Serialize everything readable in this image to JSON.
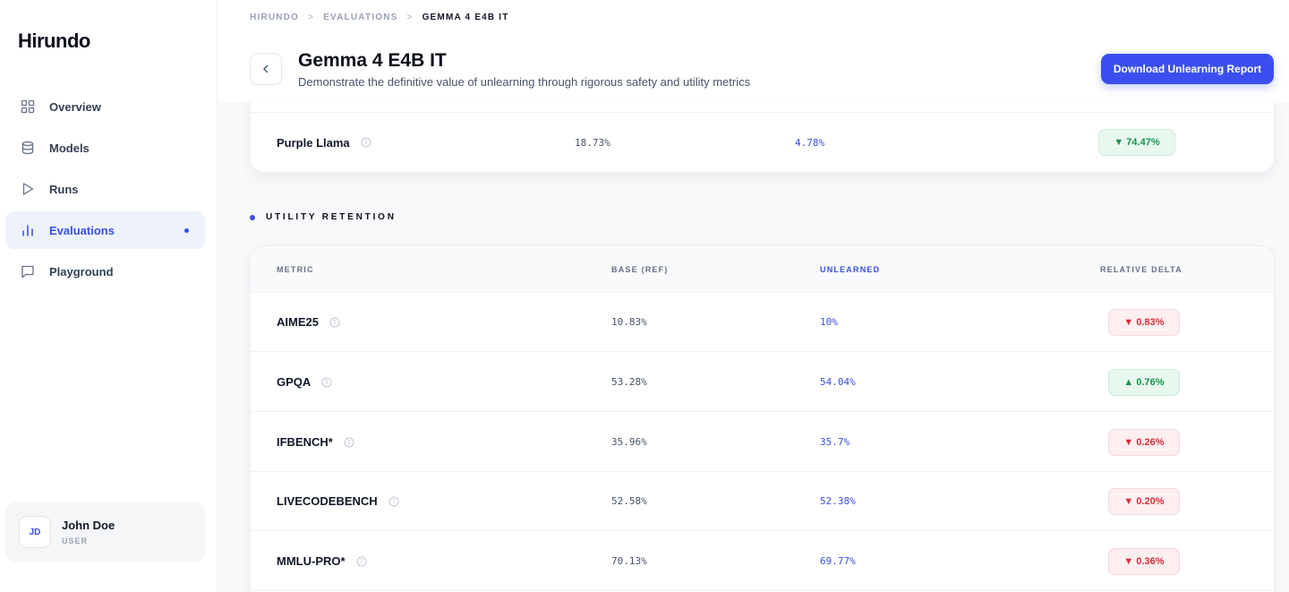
{
  "sidebar": {
    "logo": "Hirundo",
    "items": [
      {
        "label": "Overview",
        "icon": "grid-icon"
      },
      {
        "label": "Models",
        "icon": "database-icon"
      },
      {
        "label": "Runs",
        "icon": "play-icon"
      },
      {
        "label": "Evaluations",
        "icon": "bar-chart-icon"
      },
      {
        "label": "Playground",
        "icon": "chat-icon"
      }
    ],
    "user": {
      "initials": "JD",
      "name": "John Doe",
      "role": "USER"
    }
  },
  "header": {
    "breadcrumb": [
      "HIRUNDO",
      "EVALUATIONS",
      "GEMMA 4 E4B IT"
    ],
    "breadcrumb_sep": ">",
    "title": "Gemma 4 E4B IT",
    "subtitle": "Demonstrate the definitive value of unlearning through rigorous safety and utility metrics",
    "download_label": "Download Unlearning Report"
  },
  "safety": {
    "rows": [
      {
        "metric": "Purple Llama",
        "base": "18.73%",
        "unlearned": "4.78%",
        "delta": "▼ 74.47%",
        "direction": "up"
      }
    ]
  },
  "utility": {
    "section_title": "UTILITY RETENTION",
    "headers": {
      "metric": "METRIC",
      "base": "BASE (REF)",
      "unlearned": "UNLEARNED",
      "delta": "RELATIVE DELTA"
    },
    "rows": [
      {
        "metric": "AIME25",
        "base": "10.83%",
        "unlearned": "10%",
        "delta": "▼ 0.83%",
        "direction": "down"
      },
      {
        "metric": "GPQA",
        "base": "53.28%",
        "unlearned": "54.04%",
        "delta": "▲ 0.76%",
        "direction": "up"
      },
      {
        "metric": "IFBENCH*",
        "base": "35.96%",
        "unlearned": "35.7%",
        "delta": "▼ 0.26%",
        "direction": "down"
      },
      {
        "metric": "LIVECODEBENCH",
        "base": "52.58%",
        "unlearned": "52.38%",
        "delta": "▼ 0.20%",
        "direction": "down"
      },
      {
        "metric": "MMLU-PRO*",
        "base": "70.13%",
        "unlearned": "69.77%",
        "delta": "▼ 0.36%",
        "direction": "down"
      }
    ]
  },
  "colors": {
    "accent": "#3a4fe0",
    "positive": "#17924a",
    "negative": "#d92d3a"
  }
}
